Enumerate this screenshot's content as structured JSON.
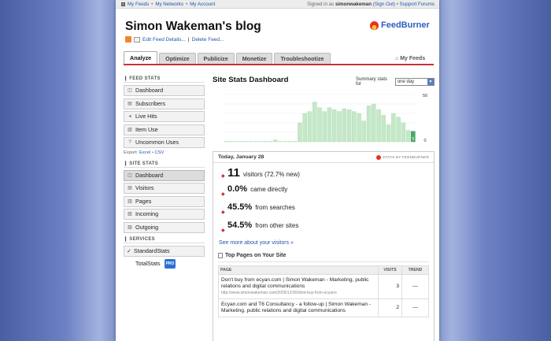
{
  "topbar": {
    "links": [
      "My Feeds",
      "My Networks",
      "My Account"
    ],
    "signed_prefix": "Signed in as",
    "username": "simonwakeman",
    "sign_out": "(Sign Out)",
    "support": "Support Forums"
  },
  "blog_title": "Simon Wakeman's blog",
  "feed_actions": {
    "edit": "Edit Feed Details...",
    "sep": "|",
    "delete": "Delete Feed..."
  },
  "logo_text": "FeedBurner",
  "tabs": [
    {
      "label": "Analyze",
      "active": true
    },
    {
      "label": "Optimize",
      "active": false
    },
    {
      "label": "Publicize",
      "active": false
    },
    {
      "label": "Monetize",
      "active": false
    },
    {
      "label": "Troubleshootize",
      "active": false
    }
  ],
  "my_feeds": "My Feeds",
  "sidebar": {
    "feed_stats_heading": "FEED STATS",
    "feed_stats": [
      {
        "label": "Dashboard",
        "icon": "dashboard-icon",
        "glyph": "◫"
      },
      {
        "label": "Subscribers",
        "icon": "subscribers-icon",
        "glyph": "▤"
      },
      {
        "label": "Live Hits",
        "icon": "live-hits-icon",
        "glyph": "◂"
      },
      {
        "label": "Item Use",
        "icon": "item-use-icon",
        "glyph": "▥"
      },
      {
        "label": "Uncommon Uses",
        "icon": "question-icon",
        "glyph": "?"
      }
    ],
    "export_label": "Export:",
    "export_excel": "Excel",
    "export_sep": "•",
    "export_csv": "CSV",
    "site_stats_heading": "SITE STATS",
    "site_stats": [
      {
        "label": "Dashboard",
        "icon": "dashboard-icon",
        "glyph": "◫",
        "active": true
      },
      {
        "label": "Visitors",
        "icon": "visitors-icon",
        "glyph": "▤"
      },
      {
        "label": "Pages",
        "icon": "pages-icon",
        "glyph": "▥"
      },
      {
        "label": "Incoming",
        "icon": "incoming-icon",
        "glyph": "▧"
      },
      {
        "label": "Outgoing",
        "icon": "outgoing-icon",
        "glyph": "▨"
      }
    ],
    "services_heading": "SERVICES",
    "services": [
      {
        "label": "StandardStats",
        "check": "✓"
      },
      {
        "label": "TotalStats",
        "badge": "PRO"
      }
    ]
  },
  "dashboard": {
    "title": "Site Stats Dashboard",
    "summary_label": "Summary stats for",
    "summary_value": "one day",
    "date": "Today, January 28",
    "stats_badge": "STATS BY FEEDBURNER",
    "stats": [
      {
        "num": "11",
        "text": "visitors (72.7% new)"
      },
      {
        "num": "0.0%",
        "text": "came directly"
      },
      {
        "num": "45.5%",
        "text": "from",
        "link": "searches"
      },
      {
        "num": "54.5%",
        "text": "from",
        "link": "other sites"
      }
    ],
    "more_link": "See more about your visitors »",
    "top_pages_title": "Top Pages on Your Site",
    "table_headers": [
      "PAGE",
      "VISITS",
      "TREND"
    ],
    "rows": [
      {
        "title": "Don't buy from ecyan.com | Simon Wakeman - Marketing, public relations and digital communications",
        "url": "http://www.simonwakeman.com/2005/12/30/dont-buy-from-ecyano",
        "visits": "3",
        "trend": "—"
      },
      {
        "title": "Ecyan.com and T6 Consultancy - a follow-up | Simon Wakeman - Marketing, public relations and digital communications",
        "url": "",
        "visits": "2",
        "trend": "—"
      }
    ]
  },
  "chart_data": {
    "type": "bar",
    "ylim": [
      0,
      50
    ],
    "y_ticks": [
      "50",
      "0"
    ],
    "values": [
      0,
      0,
      0,
      0,
      0,
      0,
      0,
      0,
      0,
      0,
      2,
      0,
      0,
      0,
      0,
      20,
      30,
      32,
      42,
      36,
      32,
      36,
      34,
      32,
      35,
      34,
      32,
      30,
      22,
      38,
      40,
      34,
      28,
      18,
      30,
      26,
      20,
      12,
      11
    ],
    "highlight_last": true,
    "last_label": "5",
    "bar_color": "#c5e8c8",
    "highlight_color": "#4aa86a"
  }
}
